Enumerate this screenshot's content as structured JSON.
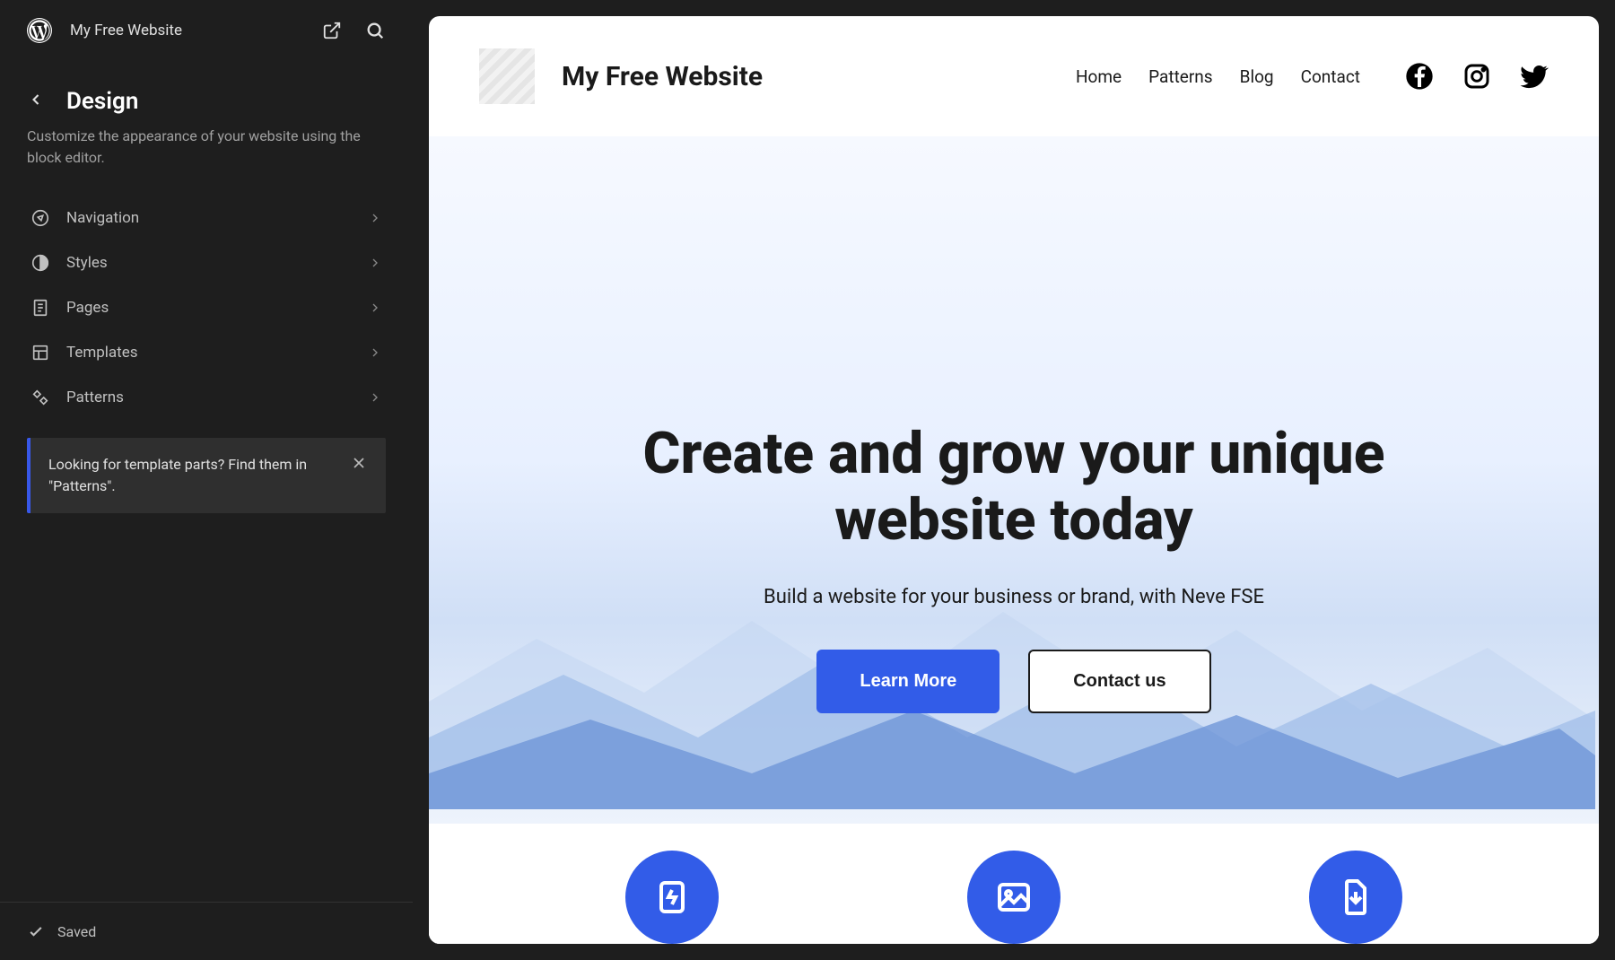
{
  "sidebar": {
    "site_name": "My Free Website",
    "panel_title": "Design",
    "panel_description": "Customize the appearance of your website using the block editor.",
    "menu": [
      {
        "label": "Navigation",
        "icon": "compass"
      },
      {
        "label": "Styles",
        "icon": "half-circle"
      },
      {
        "label": "Pages",
        "icon": "page"
      },
      {
        "label": "Templates",
        "icon": "layout"
      },
      {
        "label": "Patterns",
        "icon": "diamonds"
      }
    ],
    "notice": "Looking for template parts? Find them in \"Patterns\".",
    "footer_status": "Saved"
  },
  "preview": {
    "site_title": "My Free Website",
    "nav": [
      "Home",
      "Patterns",
      "Blog",
      "Contact"
    ],
    "hero_heading": "Create and grow your unique website today",
    "hero_sub": "Build a website for your business or brand, with Neve FSE",
    "btn_primary": "Learn More",
    "btn_outline": "Contact us"
  },
  "colors": {
    "accent": "#325ce8",
    "sidebar_bg": "#1e1e1e"
  }
}
